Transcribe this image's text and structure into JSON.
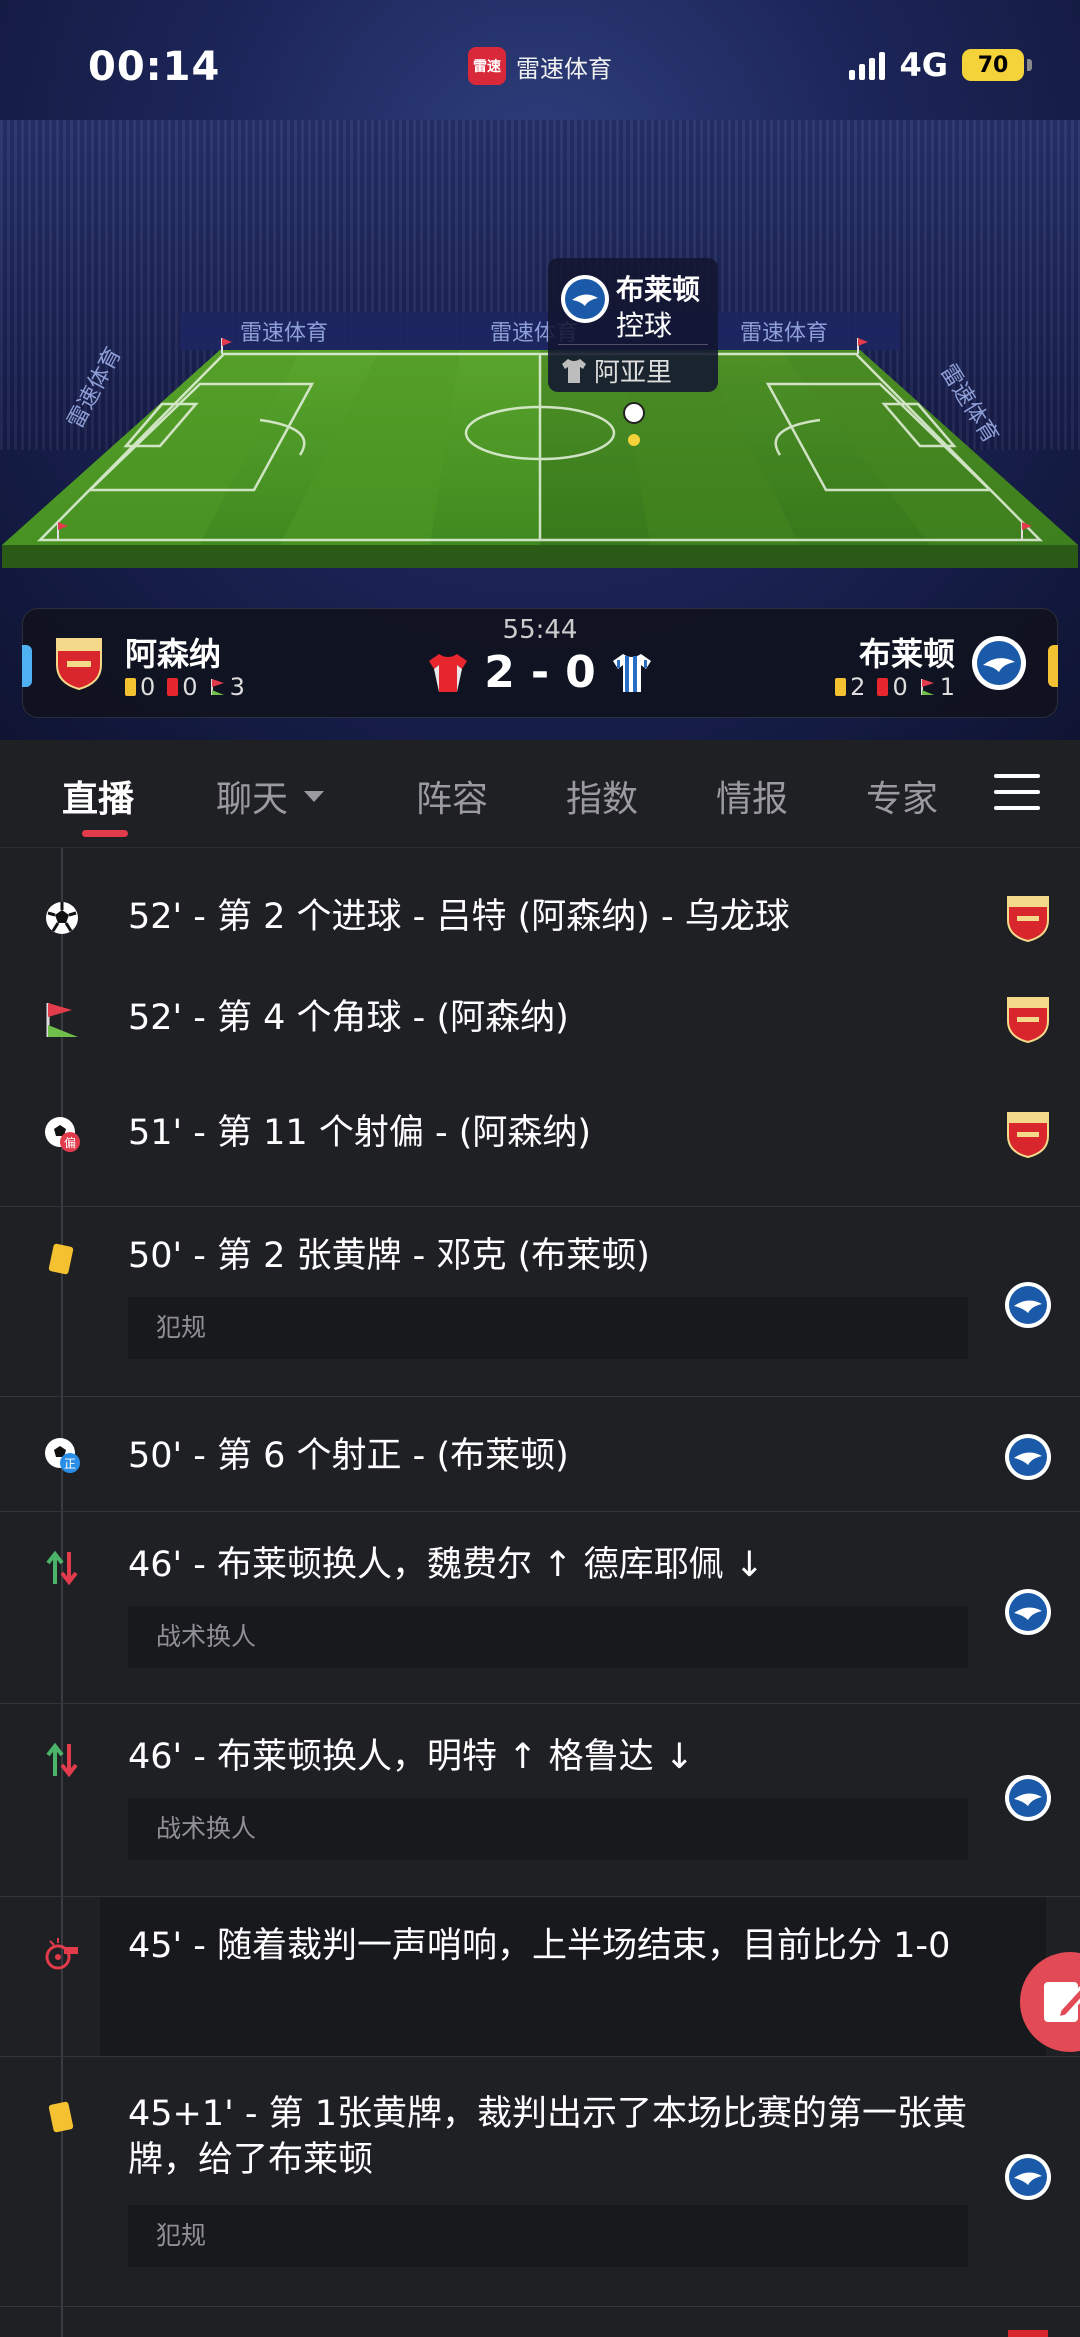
{
  "status_bar": {
    "time": "00:14",
    "app_name": "雷速体育",
    "app_logo_text": "雷速",
    "network": "4G",
    "battery": "70",
    "battery_level_percent": 70,
    "signal_bars": 4
  },
  "stadium": {
    "ad_text": "雷速体育",
    "possession_team": "布莱顿",
    "possession_state": "控球",
    "possession_player": "阿亚里"
  },
  "scoreboard": {
    "clock": "55:44",
    "home": {
      "name": "阿森纳",
      "yellow": "0",
      "red": "0",
      "corners": "3",
      "color": "#e8262d"
    },
    "away": {
      "name": "布莱顿",
      "yellow": "2",
      "red": "0",
      "corners": "1",
      "color": "#2a6dc4"
    },
    "home_score": "2",
    "separator": "-",
    "away_score": "0"
  },
  "tabs": [
    {
      "label": "直播",
      "active": true
    },
    {
      "label": "聊天",
      "active": false
    },
    {
      "label": "阵容",
      "active": false
    },
    {
      "label": "指数",
      "active": false
    },
    {
      "label": "情报",
      "active": false
    },
    {
      "label": "专家",
      "active": false
    }
  ],
  "events": [
    {
      "icon": "goal-ball-icon",
      "text": "52' - 第 2 个进球 - 吕特 (阿森纳) - 乌龙球",
      "note": "",
      "team": "arsenal"
    },
    {
      "icon": "corner-flag-icon",
      "text": "52' - 第 4 个角球 - (阿森纳)",
      "note": "",
      "team": "arsenal"
    },
    {
      "icon": "shot-off-target-icon",
      "text": "51' - 第 11 个射偏 - (阿森纳)",
      "note": "",
      "team": "arsenal"
    },
    {
      "icon": "yellow-card-icon",
      "text": "50' - 第 2 张黄牌 - 邓克 (布莱顿)",
      "note": "犯规",
      "team": "brighton"
    },
    {
      "icon": "shot-on-target-icon",
      "text": "50' - 第 6 个射正 - (布莱顿)",
      "note": "",
      "team": "brighton"
    },
    {
      "icon": "substitution-icon",
      "text": "46' - 布莱顿换人，魏费尔 ↑ 德库耶佩 ↓",
      "note": "战术换人",
      "team": "brighton"
    },
    {
      "icon": "substitution-icon",
      "text": "46' - 布莱顿换人，明特 ↑ 格鲁达 ↓",
      "note": "战术换人",
      "team": "brighton"
    },
    {
      "icon": "whistle-icon",
      "text": "45' - 随着裁判一声哨响，上半场结束，目前比分 1-0",
      "note": "",
      "team": ""
    },
    {
      "icon": "yellow-card-icon",
      "text": "45+1' - 第 1张黄牌，裁判出示了本场比赛的第一张黄牌，给了布莱顿",
      "note": "犯规",
      "team": "brighton"
    }
  ],
  "stat_sublabels": {
    "shot_off": "偏",
    "shot_on": "正"
  },
  "colors": {
    "accent": "#e23b4c",
    "background": "#1f2023",
    "note_bg": "#18191c"
  }
}
